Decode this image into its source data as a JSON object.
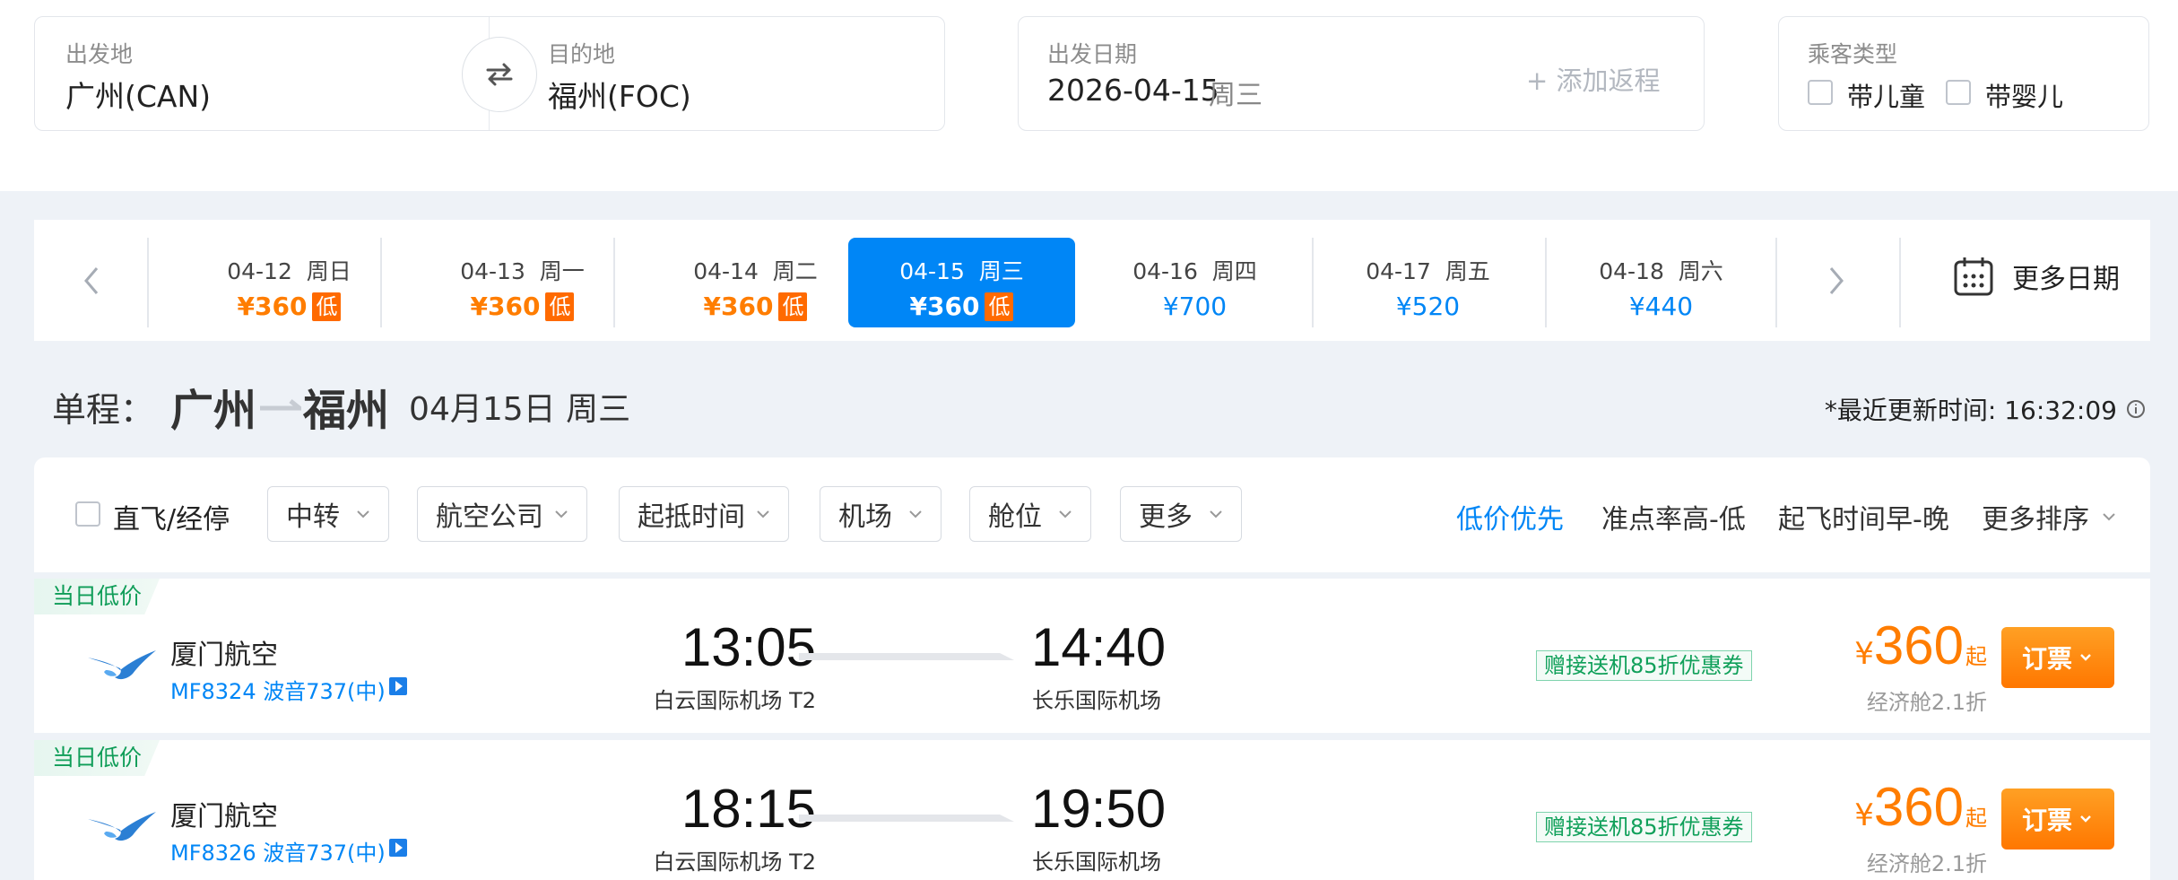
{
  "search": {
    "depart_label": "出发地",
    "depart_value": "广州(CAN)",
    "arrive_label": "目的地",
    "arrive_value": "福州(FOC)",
    "date_label": "出发日期",
    "date_value": "2026-04-15",
    "date_weekday": "周三",
    "add_return": "+ 添加返程",
    "pax_label": "乘客类型",
    "child": "带儿童",
    "infant": "带婴儿"
  },
  "dates": [
    {
      "date": "04-12",
      "wd": "周日",
      "price": "¥360",
      "low": "低"
    },
    {
      "date": "04-13",
      "wd": "周一",
      "price": "¥360",
      "low": "低"
    },
    {
      "date": "04-14",
      "wd": "周二",
      "price": "¥360",
      "low": "低"
    },
    {
      "date": "04-15",
      "wd": "周三",
      "price": "¥360",
      "low": "低"
    },
    {
      "date": "04-16",
      "wd": "周四",
      "price": "¥700",
      "low": ""
    },
    {
      "date": "04-17",
      "wd": "周五",
      "price": "¥520",
      "low": ""
    },
    {
      "date": "04-18",
      "wd": "周六",
      "price": "¥440",
      "low": ""
    }
  ],
  "more_dates": "更多日期",
  "route": {
    "prefix": "单程：",
    "from": "广州",
    "to": "福州",
    "date": "04月15日 周三",
    "updated": "*最近更新时间: 16:32:09"
  },
  "filters": {
    "direct": "直飞/经停",
    "transfer": "中转",
    "airline": "航空公司",
    "time": "起抵时间",
    "airport": "机场",
    "cabin": "舱位",
    "more": "更多"
  },
  "sorts": {
    "low": "低价优先",
    "ontime": "准点率高-低",
    "early": "起飞时间早-晚",
    "more": "更多排序"
  },
  "flights": [
    {
      "tag": "当日低价",
      "airline": "厦门航空",
      "no": "MF8324 波音737(中)",
      "dep": "13:05",
      "dep_ap": "白云国际机场 T2",
      "arr": "14:40",
      "arr_ap": "长乐国际机场",
      "coupon": "赠接送机85折优惠券",
      "yen": "¥",
      "price": "360",
      "qi": "起",
      "disc": "经济舱2.1折",
      "book": "订票"
    },
    {
      "tag": "当日低价",
      "airline": "厦门航空",
      "no": "MF8326 波音737(中)",
      "dep": "18:15",
      "dep_ap": "白云国际机场 T2",
      "arr": "19:50",
      "arr_ap": "长乐国际机场",
      "coupon": "赠接送机85折优惠券",
      "yen": "¥",
      "price": "360",
      "qi": "起",
      "disc": "经济舱2.1折",
      "book": "订票"
    }
  ],
  "colors": {
    "accent": "#0086f6",
    "price": "#ff7d00",
    "book": "#ff8a00"
  }
}
